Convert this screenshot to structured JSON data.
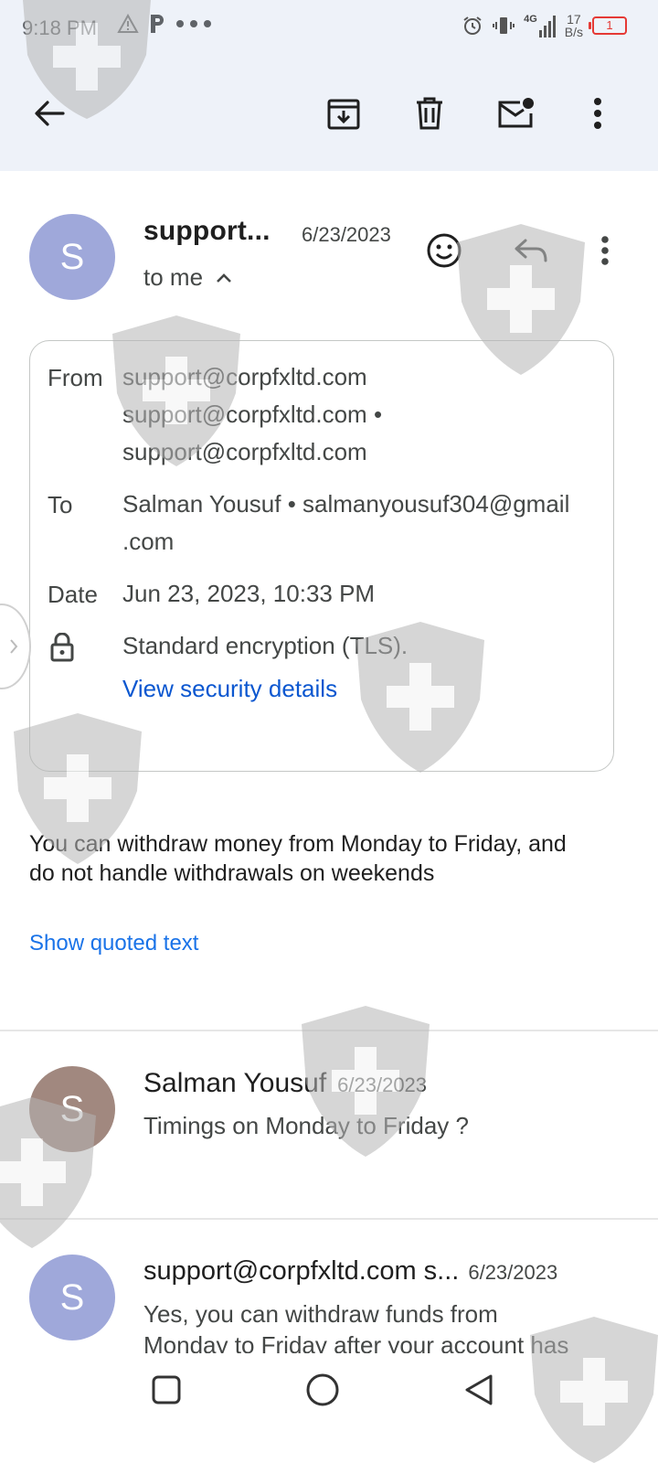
{
  "status_bar": {
    "time": "9:18 PM",
    "network_label": "4G",
    "speed_value": "17",
    "speed_unit": "B/s",
    "battery": "1"
  },
  "toolbar": {
    "icons": [
      "back-arrow-icon",
      "archive-icon",
      "delete-icon",
      "mark-unread-icon",
      "more-vert-icon"
    ]
  },
  "message": {
    "avatar_letter": "S",
    "avatar_color": "#9fa8da",
    "sender": "support...",
    "date": "6/23/2023",
    "to_me": "to me",
    "details": {
      "from_label": "From",
      "from_lines": [
        "support@corpfxltd.com",
        "support@corpfxltd.com •",
        "support@corpfxltd.com"
      ],
      "to_label": "To",
      "to_lines": [
        "Salman Yousuf • salmanyousuf304@gmail",
        ".com"
      ],
      "date_label": "Date",
      "date_value": "Jun 23, 2023, 10:33 PM",
      "encryption": "Standard encryption (TLS).",
      "security_link": "View security details"
    },
    "body_lines": [
      "You can withdraw money from Monday to Friday, and",
      "do not handle withdrawals on weekends"
    ],
    "show_quoted": "Show quoted text"
  },
  "thread": [
    {
      "avatar_letter": "S",
      "avatar_color": "#a1887f",
      "name": "Salman Yousuf",
      "date": "6/23/2023",
      "snippet_lines": [
        "Timings on Monday to Friday ?"
      ]
    },
    {
      "avatar_letter": "S",
      "avatar_color": "#9fa8da",
      "name": "support@corpfxltd.com s...",
      "date": "6/23/2023",
      "snippet_lines": [
        "Yes, you can withdraw funds from",
        "Monday to Friday after your account has"
      ]
    }
  ]
}
